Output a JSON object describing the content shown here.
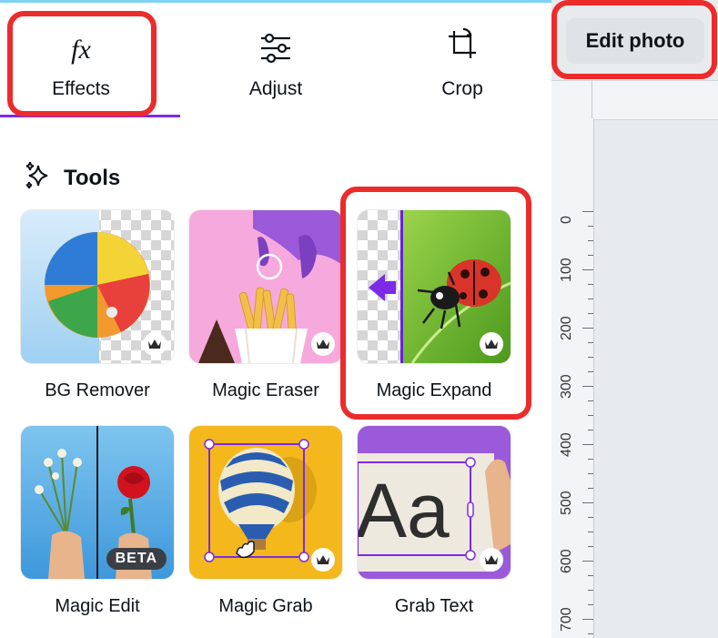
{
  "tabs": [
    {
      "label": "Effects",
      "icon": "fx-icon",
      "active": true
    },
    {
      "label": "Adjust",
      "icon": "sliders-icon"
    },
    {
      "label": "Crop",
      "icon": "crop-icon"
    }
  ],
  "tabs_fx_glyph": "fx",
  "section": {
    "title": "Tools",
    "icon": "sparkles-icon"
  },
  "tools": [
    {
      "name": "BG Remover",
      "pro": true
    },
    {
      "name": "Magic Eraser",
      "pro": true
    },
    {
      "name": "Magic Expand",
      "pro": true
    },
    {
      "name": "Magic Edit",
      "badge": "BETA"
    },
    {
      "name": "Magic Grab",
      "pro": true
    },
    {
      "name": "Grab Text",
      "pro": true
    }
  ],
  "grab_text_sample": "Aa",
  "edit_photo_button": "Edit photo",
  "ruler_labels": [
    "0",
    "100",
    "200",
    "300",
    "400",
    "500",
    "600",
    "700"
  ],
  "colors": {
    "accent": "#7d2ae8",
    "highlight": "#ec2b2b"
  }
}
